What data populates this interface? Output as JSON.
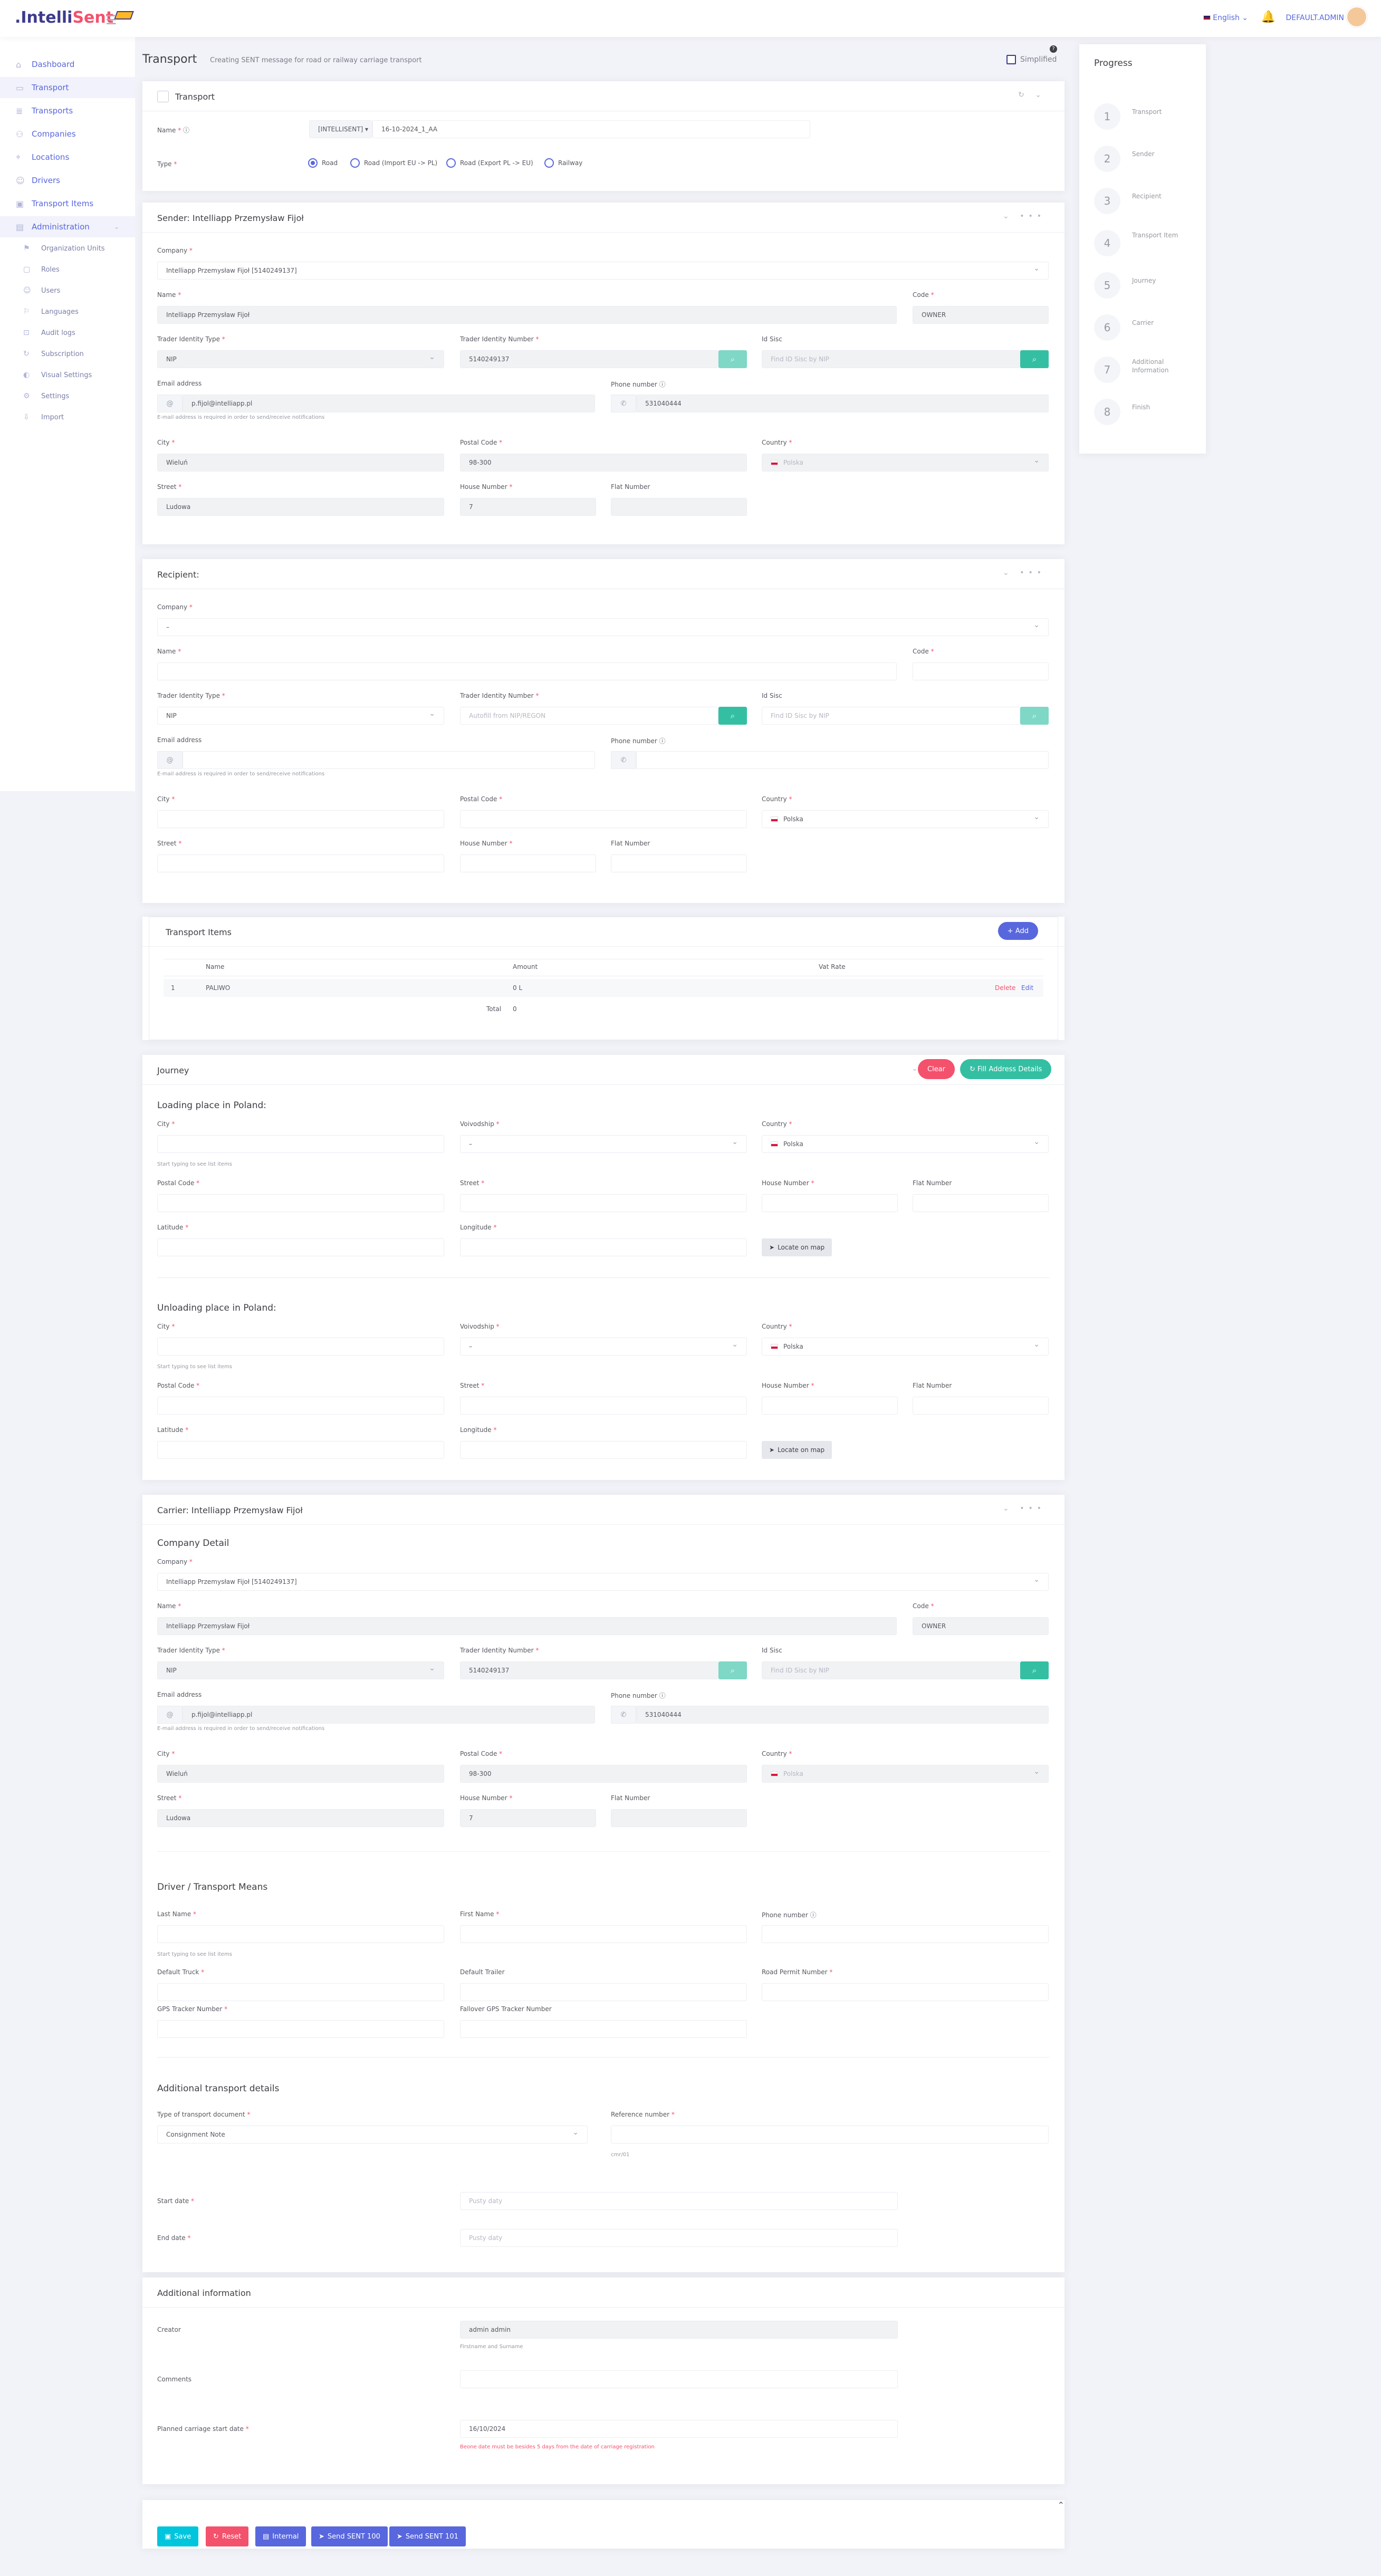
{
  "topbar": {
    "logo_intelli": ".Intelli",
    "logo_sent": "Sent",
    "language": "English ⌄",
    "username": "DEFAULT.ADMIN"
  },
  "sidebar": {
    "items": [
      {
        "label": "Dashboard"
      },
      {
        "label": "Transport"
      },
      {
        "label": "Transports"
      },
      {
        "label": "Companies"
      },
      {
        "label": "Locations"
      },
      {
        "label": "Drivers"
      },
      {
        "label": "Transport Items"
      },
      {
        "label": "Administration"
      }
    ],
    "admin_items": [
      {
        "label": "Organization Units"
      },
      {
        "label": "Roles"
      },
      {
        "label": "Users"
      },
      {
        "label": "Languages"
      },
      {
        "label": "Audit logs"
      },
      {
        "label": "Subscription"
      },
      {
        "label": "Visual Settings"
      },
      {
        "label": "Settings"
      },
      {
        "label": "Import"
      }
    ]
  },
  "header": {
    "title": "Transport",
    "subtitle": "Creating SENT message for road or railway carriage transport",
    "simplified_label": "Simplified"
  },
  "transport": {
    "title": "Transport",
    "name_label": "Name",
    "prefix": "[INTELLISENT] ▾",
    "name_value": "16-10-2024_1_AA",
    "type_label": "Type",
    "types": [
      "Road",
      "Road (Import EU -> PL)",
      "Road (Export PL -> EU)",
      "Railway"
    ]
  },
  "sender": {
    "title": "Sender: Intelliapp Przemysław Fijoł",
    "company_label": "Company",
    "company_value": "Intelliapp Przemysław Fijoł [5140249137]",
    "name_label": "Name",
    "name_value": "Intelliapp Przemysław Fijoł",
    "code_label": "Code",
    "code_value": "OWNER",
    "trader_type_label": "Trader Identity Type",
    "trader_type_value": "NIP",
    "trader_number_label": "Trader Identity Number",
    "trader_number_value": "5140249137",
    "idsisc_label": "Id Sisc",
    "idsisc_placeholder": "Find ID Sisc by NIP",
    "email_label": "Email address",
    "email_value": "p.fijol@intelliapp.pl",
    "email_hint": "E-mail address is required in order to send/receive notifications",
    "phone_label": "Phone number",
    "phone_value": "531040444",
    "city_label": "City",
    "city_value": "Wieluń",
    "postal_label": "Postal Code",
    "postal_value": "98-300",
    "country_label": "Country",
    "country_value": "Polska",
    "street_label": "Street",
    "street_value": "Ludowa",
    "house_label": "House Number",
    "house_value": "7",
    "flat_label": "Flat Number"
  },
  "recipient": {
    "title": "Recipient:",
    "company_label": "Company",
    "company_value": "–",
    "name_label": "Name",
    "code_label": "Code",
    "trader_type_label": "Trader Identity Type",
    "trader_type_value": "NIP",
    "trader_number_label": "Trader Identity Number",
    "trader_number_placeholder": "Autofill from NIP/REGON",
    "idsisc_label": "Id Sisc",
    "idsisc_placeholder": "Find ID Sisc by NIP",
    "email_label": "Email address",
    "email_hint": "E-mail address is required in order to send/receive notifications",
    "phone_label": "Phone number",
    "city_label": "City",
    "postal_label": "Postal Code",
    "country_label": "Country",
    "country_value": "Polska",
    "street_label": "Street",
    "house_label": "House Number",
    "flat_label": "Flat Number"
  },
  "items": {
    "title": "Transport Items",
    "add_label": "+ Add",
    "columns": [
      "Name",
      "Amount",
      "Vat Rate"
    ],
    "rows": [
      {
        "idx": "1",
        "name": "PALIWO",
        "amount": "0 L",
        "vat": "",
        "delete": "Delete",
        "edit": "Edit"
      }
    ],
    "total_label": "Total",
    "total_value": "0"
  },
  "journey": {
    "title": "Journey",
    "clear_label": "Clear",
    "fill_label": "Fill Address Details",
    "loading_title": "Loading place in Poland:",
    "unloading_title": "Unloading place in Poland:",
    "city_label": "City",
    "voivodship_label": "Voivodship",
    "voivodship_value": "–",
    "country_label": "Country",
    "country_value": "Polska",
    "city_hint": "Start typing to see list items",
    "postal_label": "Postal Code",
    "street_label": "Street",
    "house_label": "House Number",
    "flat_label": "Flat Number",
    "lat_label": "Latitude",
    "lng_label": "Longitude",
    "locate_label": "Locate on map"
  },
  "carrier": {
    "title": "Carrier: Intelliapp Przemysław Fijoł",
    "company_detail_title": "Company Detail",
    "company_label": "Company",
    "company_value": "Intelliapp Przemysław Fijoł [5140249137]",
    "name_label": "Name",
    "name_value": "Intelliapp Przemysław Fijoł",
    "code_label": "Code",
    "code_value": "OWNER",
    "trader_type_label": "Trader Identity Type",
    "trader_type_value": "NIP",
    "trader_number_label": "Trader Identity Number",
    "trader_number_value": "5140249137",
    "idsisc_label": "Id Sisc",
    "idsisc_placeholder": "Find ID Sisc by NIP",
    "email_label": "Email address",
    "email_value": "p.fijol@intelliapp.pl",
    "email_hint": "E-mail address is required in order to send/receive notifications",
    "phone_label": "Phone number",
    "phone_value": "531040444",
    "city_label": "City",
    "city_value": "Wieluń",
    "postal_label": "Postal Code",
    "postal_value": "98-300",
    "country_label": "Country",
    "country_value": "Polska",
    "street_label": "Street",
    "street_value": "Ludowa",
    "house_label": "House Number",
    "house_value": "7",
    "flat_label": "Flat Number",
    "driver_title": "Driver / Transport Means",
    "last_name_label": "Last Name",
    "first_name_label": "First Name",
    "driver_phone_label": "Phone number",
    "driver_hint": "Start typing to see list items",
    "truck_label": "Default Truck",
    "trailer_label": "Default Trailer",
    "permit_label": "Road Permit Number",
    "gps_label": "GPS Tracker Number",
    "fallback_gps_label": "Fallover GPS Tracker Number",
    "additional_title": "Additional transport details",
    "doc_type_label": "Type of transport document",
    "doc_type_value": "Consignment Note",
    "ref_label": "Reference number",
    "ref_hint": "cmr/01",
    "start_label": "Start date",
    "end_label": "End date",
    "date_placeholder": "Pusty daty"
  },
  "additional": {
    "title": "Additional information",
    "creator_label": "Creator",
    "creator_value": "admin admin",
    "creator_hint": "Firstname and Surname",
    "comments_label": "Comments",
    "planned_label": "Planned carriage start date",
    "planned_value": "16/10/2024",
    "planned_hint": "Beone date must be besides 5 days from the date of carriage registration"
  },
  "actions": {
    "save": "Save",
    "reset": "Reset",
    "internal": "Internal",
    "send100": "Send SENT 100",
    "send101": "Send SENT 101"
  },
  "progress": {
    "title": "Progress",
    "steps": [
      {
        "num": "1",
        "label": "Transport"
      },
      {
        "num": "2",
        "label": "Sender"
      },
      {
        "num": "3",
        "label": "Recipient"
      },
      {
        "num": "4",
        "label": "Transport Item"
      },
      {
        "num": "5",
        "label": "Journey"
      },
      {
        "num": "6",
        "label": "Carrier"
      },
      {
        "num": "7",
        "label": "Additional Information"
      },
      {
        "num": "8",
        "label": "Finish"
      }
    ]
  }
}
